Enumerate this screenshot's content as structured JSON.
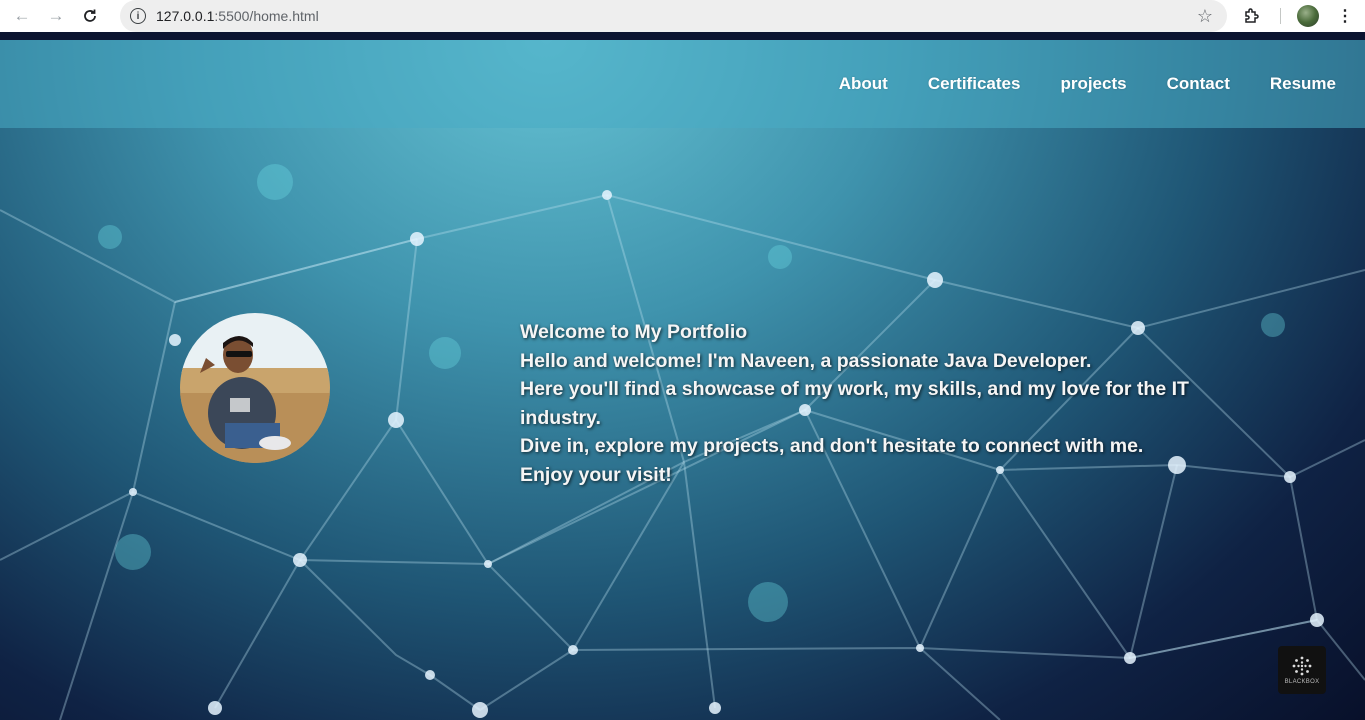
{
  "browser": {
    "url_host": "127.0.0.1",
    "url_rest": ":5500/home.html",
    "icons": [
      "back-arrow-icon",
      "forward-arrow-icon",
      "reload-icon",
      "site-info-icon",
      "bookmark-star-icon",
      "extensions-puzzle-icon",
      "profile-avatar",
      "more-options-icon"
    ]
  },
  "nav": {
    "items": [
      "About",
      "Certificates",
      "projects",
      "Contact",
      "Resume"
    ]
  },
  "intro": {
    "lines": [
      "Welcome to My Portfolio",
      "Hello and welcome! I'm Naveen, a passionate Java Developer.",
      "Here you'll find a showcase of my work, my skills, and my love for the IT industry.",
      "Dive in, explore my projects, and don't hesitate to connect with me.",
      "Enjoy your visit!"
    ]
  },
  "widget": {
    "label": "BLACKBOX"
  },
  "colors": {
    "header": "#48acc4",
    "text": "#f5f5f5",
    "nav_text": "#ffffff"
  }
}
